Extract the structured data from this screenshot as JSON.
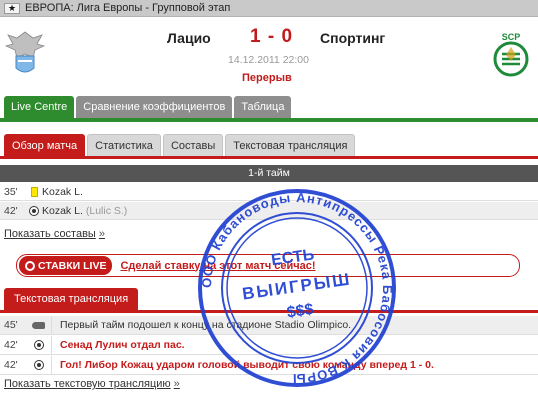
{
  "header": {
    "competition": "ЕВРОПА: Лига Европы - Групповой этап"
  },
  "match": {
    "home_team": "Лацио",
    "away_team": "Спортинг",
    "score": "1 - 0",
    "datetime": "14.12.2011 22:00",
    "status": "Перерыв",
    "away_logo_text": "SCP",
    "away_logo_ring": "SPORTING · PORTUGAL"
  },
  "main_tabs": [
    {
      "label": "Live Centre"
    },
    {
      "label": "Сравнение коэффициентов"
    },
    {
      "label": "Таблица"
    }
  ],
  "sub_tabs": [
    {
      "label": "Обзор матча"
    },
    {
      "label": "Статистика"
    },
    {
      "label": "Составы"
    },
    {
      "label": "Текстовая трансляция"
    }
  ],
  "events": {
    "half_label": "1-й тайм",
    "rows": [
      {
        "minute": "35'",
        "icon": "yellow-card-icon",
        "player": "Kozak L.",
        "assist": ""
      },
      {
        "minute": "42'",
        "icon": "goal-ball-icon",
        "player": "Kozak L.",
        "assist": "(Lulic S.)"
      }
    ],
    "show_lineups_link": "Показать составы",
    "arrow": "»"
  },
  "bet": {
    "button": "СТАВКИ LIVE",
    "link": "Сделай ставку на этот матч сейчас!"
  },
  "commentary": {
    "tab_label": "Текстовая трансляция",
    "rows": [
      {
        "minute": "45'",
        "icon": "whistle-icon",
        "text": "Первый тайм подошел к концу на стадионе Stadio Olimpico.",
        "highlight": false
      },
      {
        "minute": "42'",
        "icon": "goal-ball-icon",
        "text": "Сенад Лулич отдал пас.",
        "highlight": true
      },
      {
        "minute": "42'",
        "icon": "goal-ball-icon",
        "text": "Гол! Либор Кожац ударом головой выводит свою команду вперед 1 - 0.",
        "highlight": true
      }
    ],
    "show_link": "Показать текстовую трансляцию"
  },
  "stamp": {
    "ring_text": "ООО Кабановоды Антипрессы Река Бабосовия К.ВОРЫ",
    "line1": "ЕСТЬ",
    "line2": "ВЫИГРЫШ",
    "line3": "$$$",
    "color": "#1f3fd1"
  },
  "colors": {
    "accent_red": "#c41b1b",
    "accent_green": "#2e8b2e"
  }
}
